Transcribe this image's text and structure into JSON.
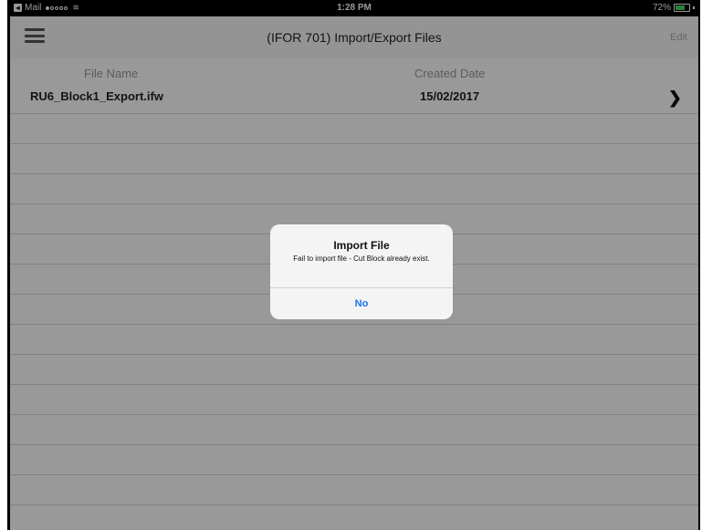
{
  "status_bar": {
    "back_label": "Mail",
    "time": "1:28 PM",
    "battery": "72%",
    "battery_level": 0.72
  },
  "navbar": {
    "title": "(IFOR 701) Import/Export Files",
    "edit_label": "Edit"
  },
  "table": {
    "columns": [
      "File Name",
      "Created Date"
    ],
    "rows": [
      {
        "file_name": "RU6_Block1_Export.ifw",
        "created_date": "15/02/2017"
      }
    ]
  },
  "alert": {
    "title": "Import File",
    "message": "Fail to import file - Cut Block already exist.",
    "button": "No"
  },
  "colors": {
    "accent": "#1a73e8",
    "battery": "#4cd964"
  }
}
